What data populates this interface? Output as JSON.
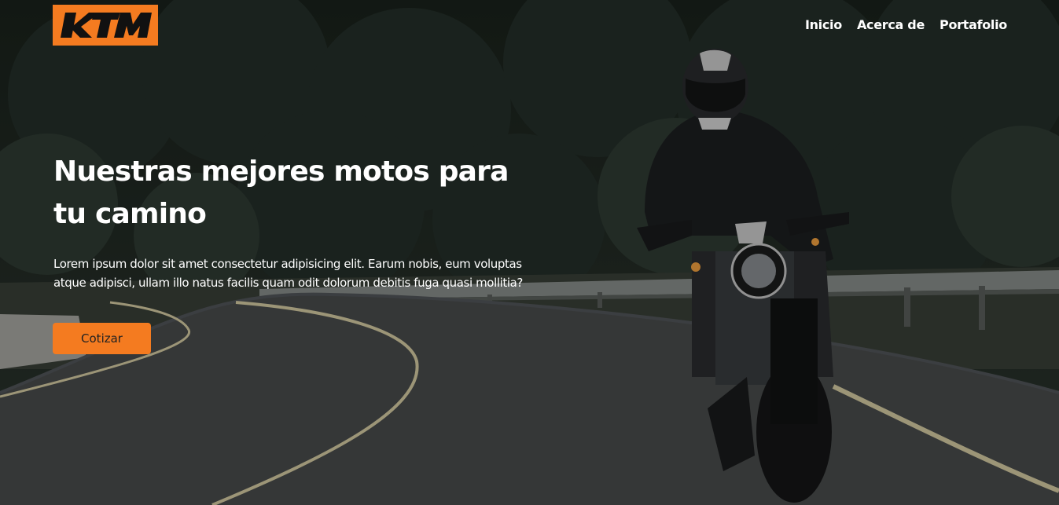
{
  "brand": {
    "logo_text": "KTM",
    "accent": "#f47b20"
  },
  "nav": {
    "items": [
      {
        "label": "Inicio"
      },
      {
        "label": "Acerca de"
      },
      {
        "label": "Portafolio"
      }
    ]
  },
  "hero": {
    "title": "Nuestras mejores motos para tu camino",
    "description": "Lorem ipsum dolor sit amet consectetur adipisicing elit. Earum nobis, eum voluptas atque adipisci, ullam illo natus facilis quam odit dolorum debitis fuga quasi mollitia?",
    "cta_label": "Cotizar",
    "background_image": "motorcyclist-on-forest-road"
  }
}
